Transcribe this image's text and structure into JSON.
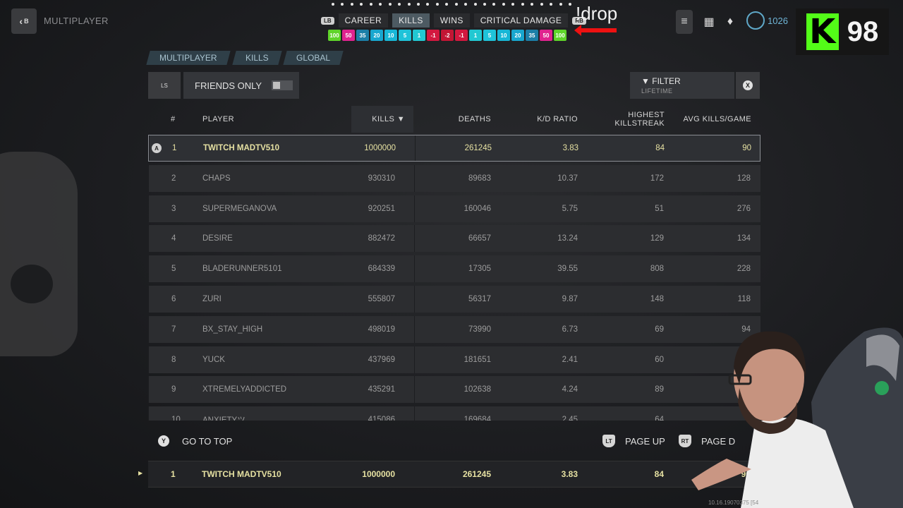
{
  "top_bar": {
    "back_glyph": "B",
    "title": "MULTIPLAYER"
  },
  "tabs": {
    "left_bumper": "LB",
    "right_bumper": "RB",
    "items": [
      "CAREER",
      "KILLS",
      "WINS",
      "CRITICAL DAMAGE"
    ],
    "active": "KILLS"
  },
  "overlay": {
    "drop_label": "!drop",
    "chips": [
      {
        "label": "100",
        "color": "#5fd42a"
      },
      {
        "label": "50",
        "color": "#e0238f"
      },
      {
        "label": "35",
        "color": "#1c7fa8"
      },
      {
        "label": "20",
        "color": "#18a7cf"
      },
      {
        "label": "10",
        "color": "#18b7d6"
      },
      {
        "label": "5",
        "color": "#1fc3d9"
      },
      {
        "label": "1",
        "color": "#22c8d2"
      },
      {
        "label": "-1",
        "color": "#d3183f"
      },
      {
        "label": "-2",
        "color": "#c21634"
      },
      {
        "label": "-1",
        "color": "#d3183f"
      },
      {
        "label": "1",
        "color": "#22c8d2"
      },
      {
        "label": "5",
        "color": "#1fc3d9"
      },
      {
        "label": "10",
        "color": "#18b7d6"
      },
      {
        "label": "20",
        "color": "#18a7cf"
      },
      {
        "label": "35",
        "color": "#1c7fa8"
      },
      {
        "label": "50",
        "color": "#e0238f"
      },
      {
        "label": "100",
        "color": "#5fd42a"
      }
    ],
    "kick_count": "98"
  },
  "top_right": {
    "points": "1026"
  },
  "breadcrumbs": [
    "MULTIPLAYER",
    "KILLS",
    "GLOBAL"
  ],
  "controls": {
    "ls_label": "LS",
    "friends_only": "FRIENDS ONLY",
    "filter_label": "FILTER",
    "filter_value": "LIFETIME",
    "close_glyph": "X"
  },
  "table": {
    "headers": {
      "rank": "#",
      "player": "PLAYER",
      "kills": "KILLS ▼",
      "deaths": "DEATHS",
      "kd": "K/D RATIO",
      "streak_1": "HIGHEST",
      "streak_2": "KILLSTREAK",
      "avg": "AVG KILLS/GAME"
    },
    "rows": [
      {
        "rank": "1",
        "player": "TWITCH MADTV510",
        "kills": "1000000",
        "deaths": "261245",
        "kd": "3.83",
        "streak": "84",
        "avg": "90",
        "selected": true,
        "badge": "A"
      },
      {
        "rank": "2",
        "player": "CHAPS",
        "kills": "930310",
        "deaths": "89683",
        "kd": "10.37",
        "streak": "172",
        "avg": "128"
      },
      {
        "rank": "3",
        "player": "SUPERMEGANOVA",
        "kills": "920251",
        "deaths": "160046",
        "kd": "5.75",
        "streak": "51",
        "avg": "276"
      },
      {
        "rank": "4",
        "player": "DESIRE",
        "kills": "882472",
        "deaths": "66657",
        "kd": "13.24",
        "streak": "129",
        "avg": "134"
      },
      {
        "rank": "5",
        "player": "BLADERUNNER5101",
        "kills": "684339",
        "deaths": "17305",
        "kd": "39.55",
        "streak": "808",
        "avg": "228"
      },
      {
        "rank": "6",
        "player": "ZURI",
        "kills": "555807",
        "deaths": "56317",
        "kd": "9.87",
        "streak": "148",
        "avg": "118"
      },
      {
        "rank": "7",
        "player": "BX_STAY_HIGH",
        "kills": "498019",
        "deaths": "73990",
        "kd": "6.73",
        "streak": "69",
        "avg": "94"
      },
      {
        "rank": "8",
        "player": "YUCK",
        "kills": "437969",
        "deaths": "181651",
        "kd": "2.41",
        "streak": "60",
        "avg": ""
      },
      {
        "rank": "9",
        "player": "XTREMELYADDICTED",
        "kills": "435291",
        "deaths": "102638",
        "kd": "4.24",
        "streak": "89",
        "avg": ""
      },
      {
        "rank": "10",
        "player": "ANXIETYツ",
        "kills": "415086",
        "deaths": "169684",
        "kd": "2.45",
        "streak": "64",
        "avg": ""
      }
    ]
  },
  "bottom": {
    "go_top_glyph": "Y",
    "go_top": "GO TO TOP",
    "lt_glyph": "LT",
    "page_up": "PAGE UP",
    "rt_glyph": "RT",
    "page_down": "PAGE D"
  },
  "pinned_row": {
    "rank": "1",
    "player": "TWITCH MADTV510",
    "kills": "1000000",
    "deaths": "261245",
    "kd": "3.83",
    "streak": "84",
    "avg": "90"
  },
  "footer_id": "10.16.19070375 [54"
}
